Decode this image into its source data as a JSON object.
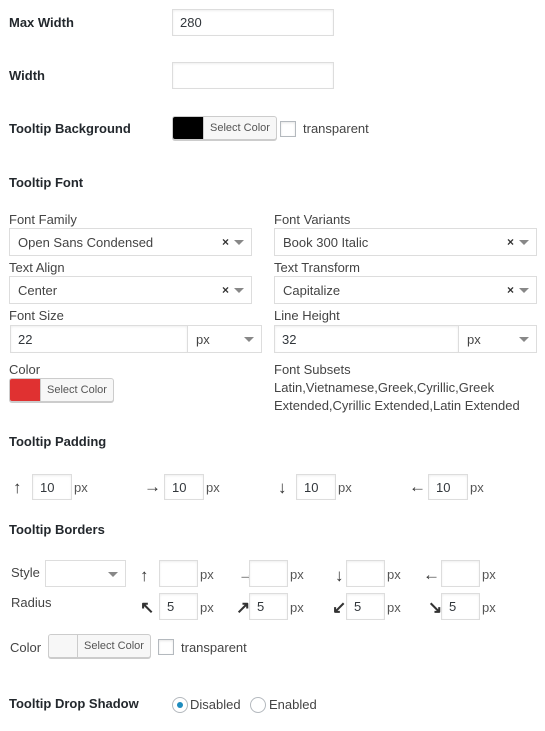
{
  "max_width": {
    "label": "Max Width",
    "value": "280"
  },
  "width": {
    "label": "Width",
    "value": ""
  },
  "background": {
    "label": "Tooltip Background",
    "color": "#000000",
    "button": "Select Color",
    "transparent_label": "transparent",
    "transparent": false
  },
  "font": {
    "heading": "Tooltip Font",
    "family": {
      "label": "Font Family",
      "value": "Open Sans Condensed"
    },
    "variants": {
      "label": "Font Variants",
      "value": "Book 300 Italic"
    },
    "align": {
      "label": "Text Align",
      "value": "Center"
    },
    "transform": {
      "label": "Text Transform",
      "value": "Capitalize"
    },
    "size": {
      "label": "Font Size",
      "value": "22",
      "unit": "px"
    },
    "line_height": {
      "label": "Line Height",
      "value": "32",
      "unit": "px"
    },
    "color": {
      "label": "Color",
      "color": "#e03131",
      "button": "Select Color"
    },
    "subsets": {
      "label": "Font Subsets",
      "line1": "Latin,Vietnamese,Greek,Cyrillic,Greek",
      "line2": "Extended,Cyrillic Extended,Latin Extended"
    },
    "clear_icon": "×"
  },
  "padding": {
    "heading": "Tooltip Padding",
    "unit": "px",
    "top": "10",
    "right": "10",
    "bottom": "10",
    "left": "10",
    "icons": {
      "top": "↑",
      "right": "→",
      "bottom": "↓",
      "left": "←"
    }
  },
  "borders": {
    "heading": "Tooltip Borders",
    "style_label": "Style",
    "style_value": "",
    "radius_label": "Radius",
    "unit": "px",
    "width": {
      "top": "",
      "right": "",
      "bottom": "",
      "left": ""
    },
    "radius": {
      "top_left": "5",
      "top_right": "5",
      "bottom_left": "5",
      "bottom_right": "5"
    },
    "icons": {
      "top": "↑",
      "right": "→",
      "bottom": "↓",
      "left": "←",
      "top_left": "↖",
      "top_right": "↗",
      "bottom_left": "↙",
      "bottom_right": "↘"
    },
    "color_label": "Color",
    "color": "#f7f7f7",
    "button": "Select Color",
    "transparent_label": "transparent",
    "transparent": false
  },
  "shadow": {
    "label": "Tooltip Drop Shadow",
    "options": [
      "Disabled",
      "Enabled"
    ],
    "selected": "Disabled"
  }
}
